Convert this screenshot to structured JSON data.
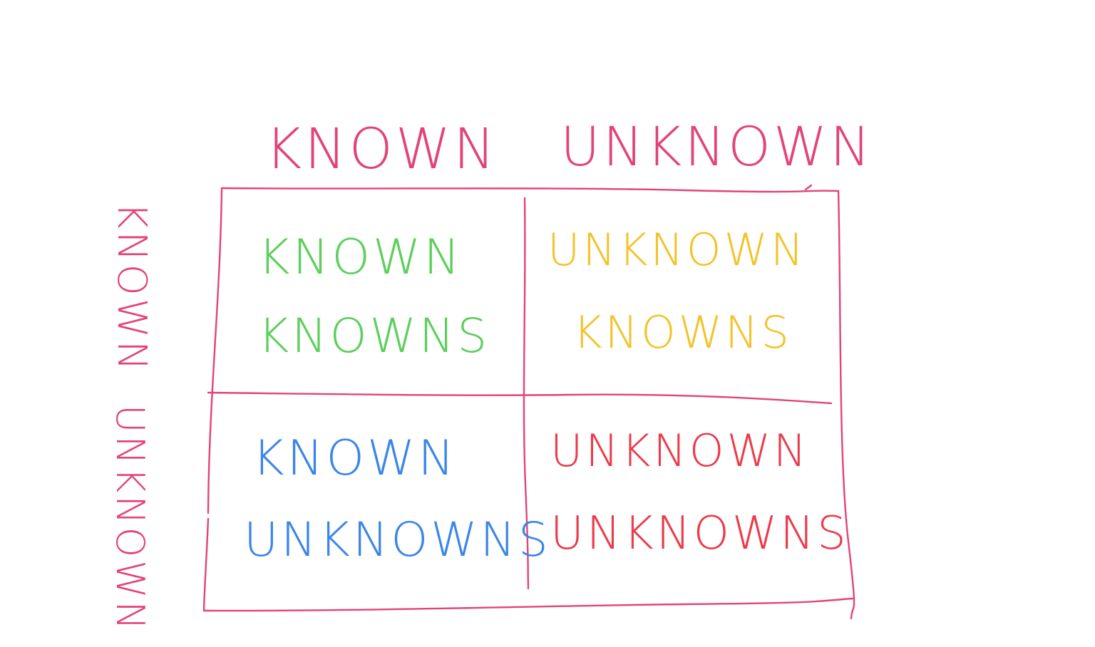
{
  "colors": {
    "grid": "#e2437a",
    "known_knowns": "#5ccf5a",
    "unknown_knowns": "#f2c32a",
    "known_unknowns": "#3a86e8",
    "unknown_unknowns": "#ec3a4a",
    "background": "#ffffff"
  },
  "columns": {
    "known": "Known",
    "unknown": "Unknown"
  },
  "rows": {
    "known": "Known",
    "unknown": "Unknown"
  },
  "cells": {
    "known_knowns": {
      "line1": "Known",
      "line2": "Knowns"
    },
    "unknown_knowns": {
      "line1": "Unknown",
      "line2": "Knowns"
    },
    "known_unknowns": {
      "line1": "Known",
      "line2": "Unknowns"
    },
    "unknown_unknowns": {
      "line1": "Unknown",
      "line2": "Unknowns"
    }
  }
}
